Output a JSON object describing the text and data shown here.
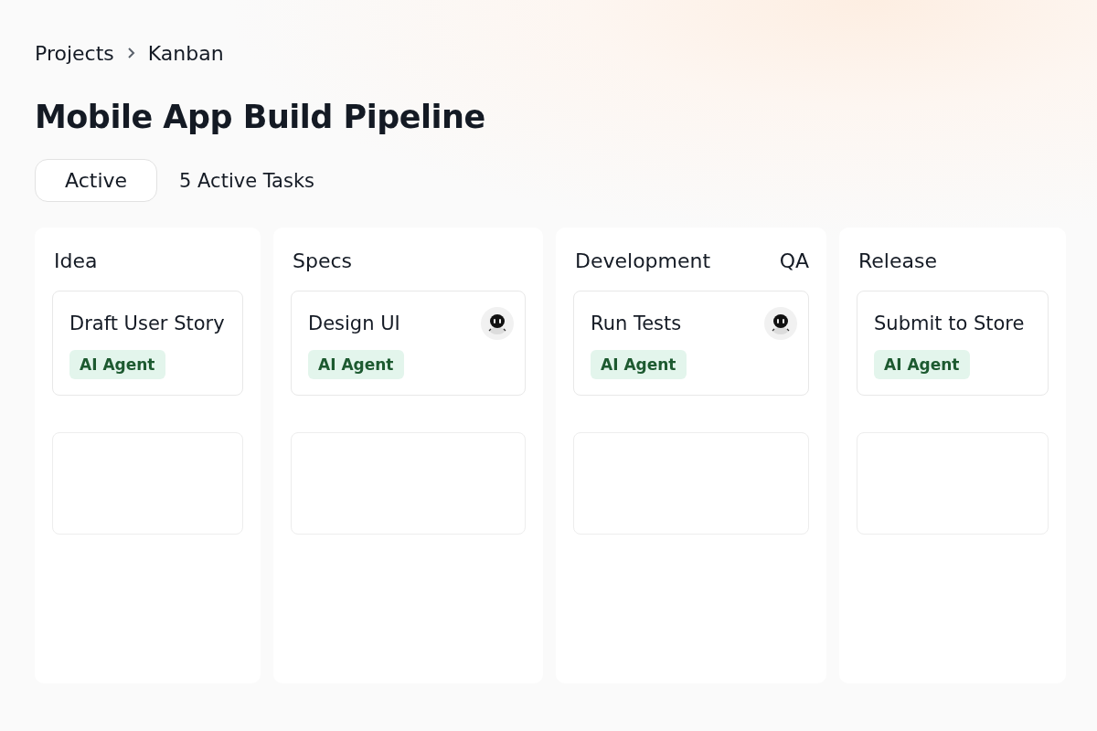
{
  "breadcrumb": [
    "Projects",
    "Kanban"
  ],
  "title": "Mobile App Build Pipeline",
  "filter": {
    "label": "Active"
  },
  "task_count": "5 Active Tasks",
  "columns": [
    {
      "title": "Idea",
      "cards": [
        {
          "kind": "task",
          "title": "Draft User Story",
          "tag": "AI Agent",
          "avatar": false
        },
        {
          "kind": "empty"
        }
      ]
    },
    {
      "title": "Specs",
      "cards": [
        {
          "kind": "task",
          "title": "Design UI",
          "tag": "AI Agent",
          "avatar": true
        },
        {
          "kind": "empty"
        }
      ]
    },
    {
      "title": "Development",
      "side_title": "QA",
      "cards": [
        {
          "kind": "task",
          "title": "Run Tests",
          "tag": "AI Agent",
          "avatar": true
        },
        {
          "kind": "empty"
        }
      ]
    },
    {
      "title": "Release",
      "cards": [
        {
          "kind": "task",
          "title": "Submit to Store",
          "tag": "AI Agent",
          "avatar": false
        },
        {
          "kind": "empty"
        }
      ]
    }
  ]
}
